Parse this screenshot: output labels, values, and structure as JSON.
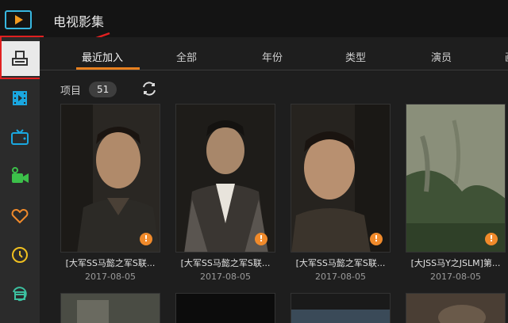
{
  "app": {
    "title": "电视影集"
  },
  "sidebar": {
    "items": [
      {
        "icon": "library-icon",
        "active": true
      },
      {
        "icon": "film-icon"
      },
      {
        "icon": "tv-icon"
      },
      {
        "icon": "camera-icon"
      },
      {
        "icon": "heart-icon"
      },
      {
        "icon": "clock-icon"
      },
      {
        "icon": "clapperboard-icon"
      }
    ]
  },
  "tabs": [
    {
      "label": "最近加入",
      "active": true
    },
    {
      "label": "全部"
    },
    {
      "label": "年份"
    },
    {
      "label": "类型"
    },
    {
      "label": "演员"
    },
    {
      "label": "画"
    }
  ],
  "items_bar": {
    "label": "项目",
    "count": "51"
  },
  "cards": [
    {
      "title": "[大军SS马懿之军S联...",
      "date": "2017-08-05"
    },
    {
      "title": "[大军SS马懿之军S联...",
      "date": "2017-08-05"
    },
    {
      "title": "[大军SS马懿之军S联...",
      "date": "2017-08-05"
    },
    {
      "title": "[大JSS马Y之JSLM]第...",
      "date": "2017-08-05"
    }
  ],
  "colors": {
    "accent": "#e8801f",
    "warning": "#f08a2b",
    "annotation": "#e02020",
    "logo": "#38b7e0"
  }
}
